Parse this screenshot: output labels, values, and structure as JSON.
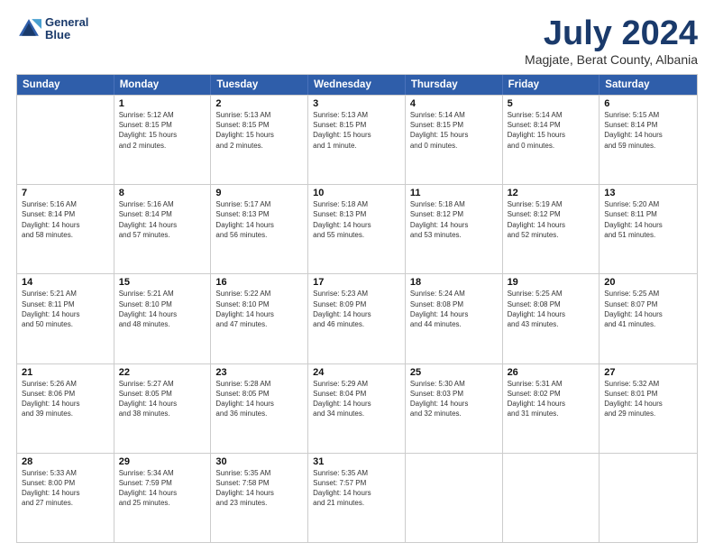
{
  "header": {
    "logo_line1": "General",
    "logo_line2": "Blue",
    "month": "July 2024",
    "location": "Magjate, Berat County, Albania"
  },
  "days_of_week": [
    "Sunday",
    "Monday",
    "Tuesday",
    "Wednesday",
    "Thursday",
    "Friday",
    "Saturday"
  ],
  "weeks": [
    [
      {
        "day": "",
        "lines": []
      },
      {
        "day": "1",
        "lines": [
          "Sunrise: 5:12 AM",
          "Sunset: 8:15 PM",
          "Daylight: 15 hours",
          "and 2 minutes."
        ]
      },
      {
        "day": "2",
        "lines": [
          "Sunrise: 5:13 AM",
          "Sunset: 8:15 PM",
          "Daylight: 15 hours",
          "and 2 minutes."
        ]
      },
      {
        "day": "3",
        "lines": [
          "Sunrise: 5:13 AM",
          "Sunset: 8:15 PM",
          "Daylight: 15 hours",
          "and 1 minute."
        ]
      },
      {
        "day": "4",
        "lines": [
          "Sunrise: 5:14 AM",
          "Sunset: 8:15 PM",
          "Daylight: 15 hours",
          "and 0 minutes."
        ]
      },
      {
        "day": "5",
        "lines": [
          "Sunrise: 5:14 AM",
          "Sunset: 8:14 PM",
          "Daylight: 15 hours",
          "and 0 minutes."
        ]
      },
      {
        "day": "6",
        "lines": [
          "Sunrise: 5:15 AM",
          "Sunset: 8:14 PM",
          "Daylight: 14 hours",
          "and 59 minutes."
        ]
      }
    ],
    [
      {
        "day": "7",
        "lines": [
          "Sunrise: 5:16 AM",
          "Sunset: 8:14 PM",
          "Daylight: 14 hours",
          "and 58 minutes."
        ]
      },
      {
        "day": "8",
        "lines": [
          "Sunrise: 5:16 AM",
          "Sunset: 8:14 PM",
          "Daylight: 14 hours",
          "and 57 minutes."
        ]
      },
      {
        "day": "9",
        "lines": [
          "Sunrise: 5:17 AM",
          "Sunset: 8:13 PM",
          "Daylight: 14 hours",
          "and 56 minutes."
        ]
      },
      {
        "day": "10",
        "lines": [
          "Sunrise: 5:18 AM",
          "Sunset: 8:13 PM",
          "Daylight: 14 hours",
          "and 55 minutes."
        ]
      },
      {
        "day": "11",
        "lines": [
          "Sunrise: 5:18 AM",
          "Sunset: 8:12 PM",
          "Daylight: 14 hours",
          "and 53 minutes."
        ]
      },
      {
        "day": "12",
        "lines": [
          "Sunrise: 5:19 AM",
          "Sunset: 8:12 PM",
          "Daylight: 14 hours",
          "and 52 minutes."
        ]
      },
      {
        "day": "13",
        "lines": [
          "Sunrise: 5:20 AM",
          "Sunset: 8:11 PM",
          "Daylight: 14 hours",
          "and 51 minutes."
        ]
      }
    ],
    [
      {
        "day": "14",
        "lines": [
          "Sunrise: 5:21 AM",
          "Sunset: 8:11 PM",
          "Daylight: 14 hours",
          "and 50 minutes."
        ]
      },
      {
        "day": "15",
        "lines": [
          "Sunrise: 5:21 AM",
          "Sunset: 8:10 PM",
          "Daylight: 14 hours",
          "and 48 minutes."
        ]
      },
      {
        "day": "16",
        "lines": [
          "Sunrise: 5:22 AM",
          "Sunset: 8:10 PM",
          "Daylight: 14 hours",
          "and 47 minutes."
        ]
      },
      {
        "day": "17",
        "lines": [
          "Sunrise: 5:23 AM",
          "Sunset: 8:09 PM",
          "Daylight: 14 hours",
          "and 46 minutes."
        ]
      },
      {
        "day": "18",
        "lines": [
          "Sunrise: 5:24 AM",
          "Sunset: 8:08 PM",
          "Daylight: 14 hours",
          "and 44 minutes."
        ]
      },
      {
        "day": "19",
        "lines": [
          "Sunrise: 5:25 AM",
          "Sunset: 8:08 PM",
          "Daylight: 14 hours",
          "and 43 minutes."
        ]
      },
      {
        "day": "20",
        "lines": [
          "Sunrise: 5:25 AM",
          "Sunset: 8:07 PM",
          "Daylight: 14 hours",
          "and 41 minutes."
        ]
      }
    ],
    [
      {
        "day": "21",
        "lines": [
          "Sunrise: 5:26 AM",
          "Sunset: 8:06 PM",
          "Daylight: 14 hours",
          "and 39 minutes."
        ]
      },
      {
        "day": "22",
        "lines": [
          "Sunrise: 5:27 AM",
          "Sunset: 8:05 PM",
          "Daylight: 14 hours",
          "and 38 minutes."
        ]
      },
      {
        "day": "23",
        "lines": [
          "Sunrise: 5:28 AM",
          "Sunset: 8:05 PM",
          "Daylight: 14 hours",
          "and 36 minutes."
        ]
      },
      {
        "day": "24",
        "lines": [
          "Sunrise: 5:29 AM",
          "Sunset: 8:04 PM",
          "Daylight: 14 hours",
          "and 34 minutes."
        ]
      },
      {
        "day": "25",
        "lines": [
          "Sunrise: 5:30 AM",
          "Sunset: 8:03 PM",
          "Daylight: 14 hours",
          "and 32 minutes."
        ]
      },
      {
        "day": "26",
        "lines": [
          "Sunrise: 5:31 AM",
          "Sunset: 8:02 PM",
          "Daylight: 14 hours",
          "and 31 minutes."
        ]
      },
      {
        "day": "27",
        "lines": [
          "Sunrise: 5:32 AM",
          "Sunset: 8:01 PM",
          "Daylight: 14 hours",
          "and 29 minutes."
        ]
      }
    ],
    [
      {
        "day": "28",
        "lines": [
          "Sunrise: 5:33 AM",
          "Sunset: 8:00 PM",
          "Daylight: 14 hours",
          "and 27 minutes."
        ]
      },
      {
        "day": "29",
        "lines": [
          "Sunrise: 5:34 AM",
          "Sunset: 7:59 PM",
          "Daylight: 14 hours",
          "and 25 minutes."
        ]
      },
      {
        "day": "30",
        "lines": [
          "Sunrise: 5:35 AM",
          "Sunset: 7:58 PM",
          "Daylight: 14 hours",
          "and 23 minutes."
        ]
      },
      {
        "day": "31",
        "lines": [
          "Sunrise: 5:35 AM",
          "Sunset: 7:57 PM",
          "Daylight: 14 hours",
          "and 21 minutes."
        ]
      },
      {
        "day": "",
        "lines": []
      },
      {
        "day": "",
        "lines": []
      },
      {
        "day": "",
        "lines": []
      }
    ]
  ]
}
